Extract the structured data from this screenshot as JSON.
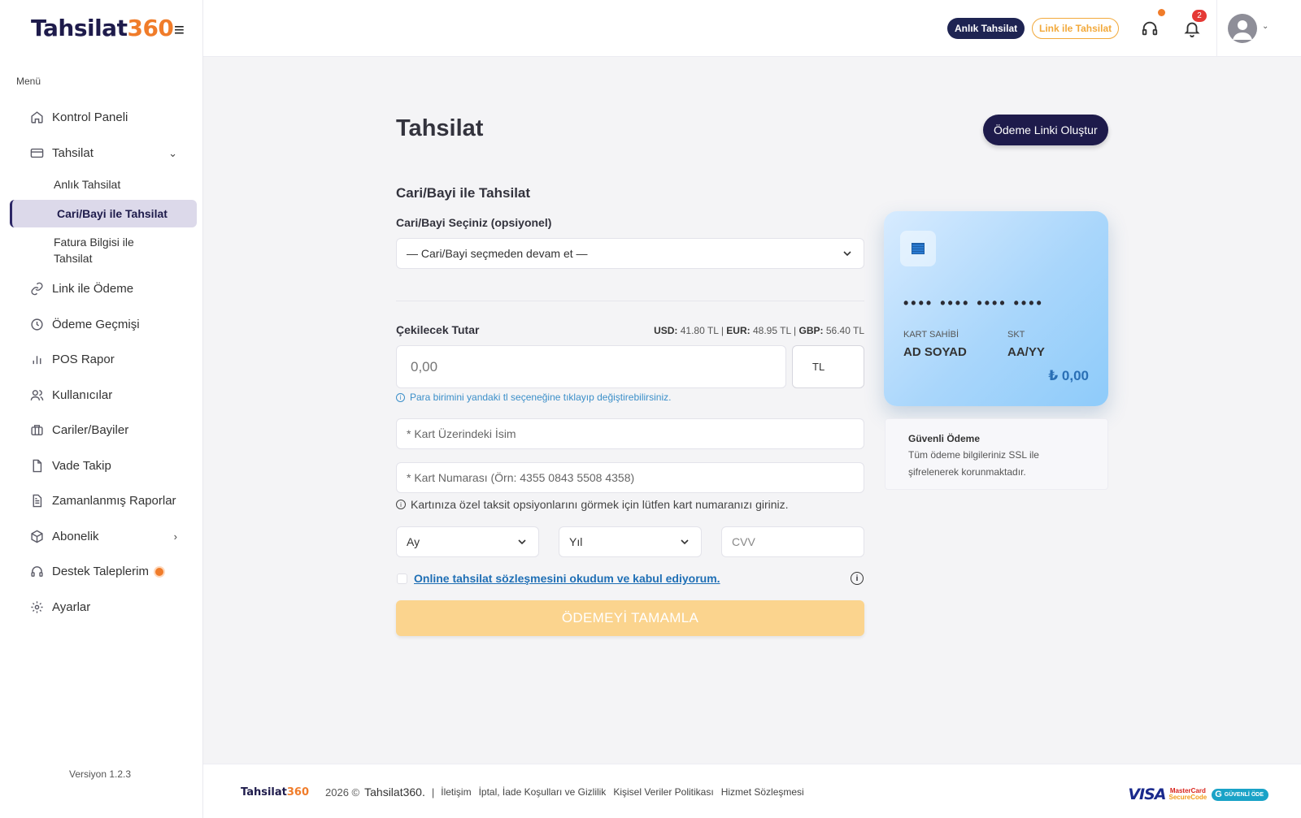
{
  "app": {
    "logo_main": "Tahsilat",
    "logo_num": "360",
    "version": "Versiyon 1.2.3"
  },
  "sidebar": {
    "menu_title": "Menü",
    "items": [
      {
        "label": "Kontrol Paneli",
        "icon": "home-icon"
      },
      {
        "label": "Tahsilat",
        "icon": "credit-card-icon"
      },
      {
        "label": "Link ile Ödeme",
        "icon": "link-icon"
      },
      {
        "label": "Ödeme Geçmişi",
        "icon": "clock-icon"
      },
      {
        "label": "POS Rapor",
        "icon": "bar-chart-icon"
      },
      {
        "label": "Kullanıcılar",
        "icon": "users-icon"
      },
      {
        "label": "Cariler/Bayiler",
        "icon": "briefcase-icon"
      },
      {
        "label": "Vade Takip",
        "icon": "file-icon"
      },
      {
        "label": "Zamanlanmış Raporlar",
        "icon": "file-text-icon"
      },
      {
        "label": "Abonelik",
        "icon": "box-icon"
      },
      {
        "label": "Destek Taleplerim",
        "icon": "headset-icon"
      },
      {
        "label": "Ayarlar",
        "icon": "gear-icon"
      }
    ],
    "sub_items": [
      {
        "label": "Anlık Tahsilat"
      },
      {
        "label": "Cari/Bayi ile Tahsilat"
      },
      {
        "label": "Fatura Bilgisi ile Tahsilat"
      }
    ]
  },
  "header": {
    "instant_btn": "Anlık Tahsilat",
    "link_btn": "Link ile Tahsilat",
    "notification_count": "2"
  },
  "main": {
    "title": "Tahsilat",
    "create_link_btn": "Ödeme Linki Oluştur",
    "section_title": "Cari/Bayi ile Tahsilat",
    "cari_label": "Cari/Bayi Seçiniz (opsiyonel)",
    "cari_selected": "— Cari/Bayi seçmeden devam et —",
    "amount_label": "Çekilecek Tutar",
    "fx": {
      "usd_label": "USD:",
      "usd_value": "41.80 TL",
      "eur_label": "EUR:",
      "eur_value": "48.95 TL",
      "gbp_label": "GBP:",
      "gbp_value": "56.40 TL",
      "sep": "|"
    },
    "amount_placeholder": "0,00",
    "currency": "TL",
    "currency_hint": "Para birimini yandaki tl seçeneğine tıklayıp değiştirebilirsiniz.",
    "name_placeholder": "* Kart Üzerindeki İsim",
    "cardno_placeholder": "* Kart Numarası (Örn: 4355 0843 5508 4358)",
    "installment_hint": "Kartınıza özel taksit opsiyonlarını görmek için lütfen kart numaranızı giriniz.",
    "month_selected": "Ay",
    "year_selected": "Yıl",
    "cvv_placeholder": "CVV",
    "terms_link": "Online tahsilat sözleşmesini okudum ve kabul ediyorum.",
    "pay_btn": "ÖDEMEYİ TAMAMLA"
  },
  "card_preview": {
    "number": "•••• •••• •••• ••••",
    "holder_label": "KART SAHİBİ",
    "holder_value": "AD SOYAD",
    "exp_label": "SKT",
    "exp_value": "AA/YY",
    "amount": "₺ 0,00"
  },
  "secure": {
    "title": "Güvenli Ödeme",
    "text": "Tüm ödeme bilgileriniz SSL ile şifrelenerek korunmaktadır."
  },
  "footer": {
    "year": "2026 ©",
    "brand": "Tahsilat360.",
    "sep": "|",
    "links": [
      "İletişim",
      "İptal, İade Koşulları ve Gizlilik",
      "Kişisel Veriler Politikası",
      "Hizmet Sözleşmesi"
    ],
    "visa": "VISA",
    "mc_top": "MasterCard",
    "mc_bottom": "SecureCode",
    "guvenli": "GÜVENLİ ÖDE"
  },
  "colors": {
    "brand_dark": "#1e1b4b",
    "accent_orange": "#f07c2a",
    "pay_button": "#fbd48e",
    "link_blue": "#1f6fb5"
  }
}
